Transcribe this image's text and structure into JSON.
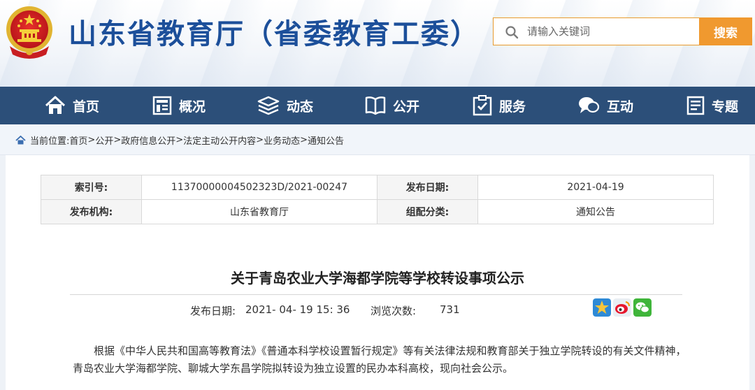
{
  "header": {
    "site_title": "山东省教育厅（省委教育工委）",
    "search_placeholder": "请输入关键词",
    "search_button": "搜索"
  },
  "nav": {
    "items": [
      {
        "label": "首页",
        "icon": "home-icon"
      },
      {
        "label": "概况",
        "icon": "overview-icon"
      },
      {
        "label": "动态",
        "icon": "news-stack-icon"
      },
      {
        "label": "公开",
        "icon": "open-book-icon"
      },
      {
        "label": "服务",
        "icon": "service-icon"
      },
      {
        "label": "互动",
        "icon": "chat-icon"
      },
      {
        "label": "专题",
        "icon": "topic-icon"
      }
    ]
  },
  "breadcrumb": {
    "prefix": "当前位置:",
    "items": [
      "首页",
      "公开",
      "政府信息公开",
      "法定主动公开内容",
      "业务动态",
      "通知公告"
    ]
  },
  "meta": {
    "index_label": "索引号:",
    "index_value": "11370000004502323D/2021-00247",
    "date_label": "发布日期:",
    "date_value": "2021-04-19",
    "org_label": "发布机构:",
    "org_value": "山东省教育厅",
    "category_label": "组配分类:",
    "category_value": "通知公告"
  },
  "article": {
    "title": "关于青岛农业大学海都学院等学校转设事项公示",
    "pub_label": "发布日期:",
    "pub_value": "2021- 04- 19 15: 36",
    "views_label": "浏览次数:",
    "views_value": "731",
    "share_icons": [
      "qzone-star-icon",
      "weibo-icon",
      "wechat-icon"
    ],
    "body": "根据《中华人民共和国高等教育法》《普通本科学校设置暂行规定》等有关法律法规和教育部关于独立学院转设的有关文件精神，青岛农业大学海都学院、聊城大学东昌学院拟转设为独立设置的民办本科高校，现向社会公示。"
  },
  "colors": {
    "nav_bg": "#2c4f79",
    "title_blue": "#1c4f9a",
    "search_orange": "#f0992f"
  }
}
